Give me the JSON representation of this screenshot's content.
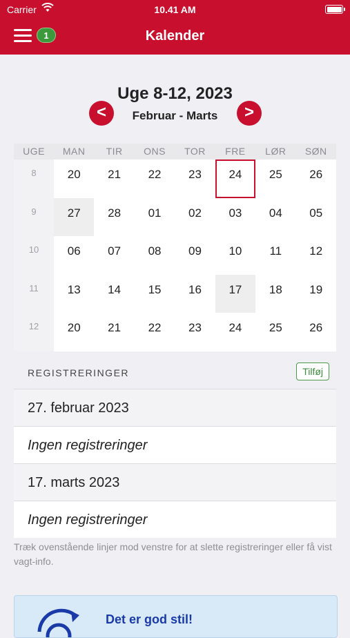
{
  "status": {
    "carrier": "Carrier",
    "time": "10.41 AM"
  },
  "nav": {
    "title": "Kalender",
    "badge": "1"
  },
  "week": {
    "title": "Uge 8-12, 2023",
    "subtitle": "Februar - Marts",
    "prev": "<",
    "next": ">"
  },
  "calendar": {
    "headers": [
      "UGE",
      "MAN",
      "TIR",
      "ONS",
      "TOR",
      "FRE",
      "LØR",
      "SØN"
    ],
    "rows": [
      {
        "week": "8",
        "days": [
          "20",
          "21",
          "22",
          "23",
          "24",
          "25",
          "26"
        ]
      },
      {
        "week": "9",
        "days": [
          "27",
          "28",
          "01",
          "02",
          "03",
          "04",
          "05"
        ]
      },
      {
        "week": "10",
        "days": [
          "06",
          "07",
          "08",
          "09",
          "10",
          "11",
          "12"
        ]
      },
      {
        "week": "11",
        "days": [
          "13",
          "14",
          "15",
          "16",
          "17",
          "18",
          "19"
        ]
      },
      {
        "week": "12",
        "days": [
          "20",
          "21",
          "22",
          "23",
          "24",
          "25",
          "26"
        ]
      }
    ],
    "selected_day": "24",
    "marked_days": [
      "27",
      "17"
    ]
  },
  "registrations": {
    "label": "REGISTRERINGER",
    "add_label": "Tilføj",
    "items": [
      {
        "date": "27. februar 2023",
        "text": "Ingen registreringer"
      },
      {
        "date": "17. marts 2023",
        "text": "Ingen registreringer"
      }
    ],
    "hint": "Træk ovenstående linjer mod venstre for at slette registreringer eller få vist vagt-info."
  },
  "card": {
    "text": "Det er god stil!"
  },
  "colors": {
    "brand": "#c8102e",
    "badge": "#3c9a3c",
    "card": "#d8e9f7"
  }
}
